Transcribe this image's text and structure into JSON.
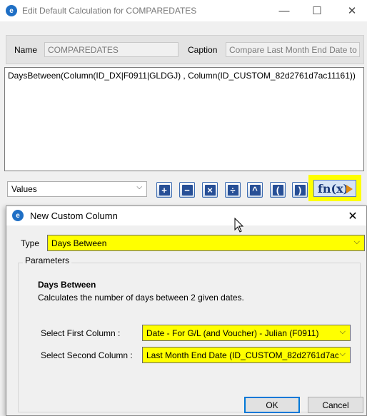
{
  "outer_window": {
    "title": "Edit Default Calculation for COMPAREDATES",
    "minimize_glyph": "—",
    "maximize_glyph": "☐",
    "close_glyph": "✕"
  },
  "name_field": {
    "label": "Name",
    "value": "COMPAREDATES"
  },
  "caption_field": {
    "label": "Caption",
    "value": "Compare Last Month End Date to C"
  },
  "expression": "DaysBetween(Column(ID_DX|F0911|GLDGJ) , Column(ID_CUSTOM_82d2761d7ac11161))",
  "values_dropdown": {
    "selected": "Values"
  },
  "operators": [
    {
      "name": "add-operator-button",
      "glyph": "+"
    },
    {
      "name": "subtract-operator-button",
      "glyph": "−"
    },
    {
      "name": "multiply-operator-button",
      "glyph": "×"
    },
    {
      "name": "divide-operator-button",
      "glyph": "÷"
    },
    {
      "name": "power-operator-button",
      "glyph": "^"
    },
    {
      "name": "open-paren-button",
      "glyph": "("
    },
    {
      "name": "close-paren-button",
      "glyph": ")"
    }
  ],
  "fn_button": {
    "label": "fn(x)"
  },
  "dialog": {
    "title": "New Custom Column",
    "close_glyph": "✕",
    "type_label": "Type",
    "type_value": "Days Between",
    "parameters_legend": "Parameters",
    "section_heading": "Days Between",
    "section_description": "Calculates the number of days between 2 given dates.",
    "first_column_label": "Select First Column :",
    "first_column_value": "Date - For G/L (and Voucher) - Julian (F0911)",
    "second_column_label": "Select Second Column :",
    "second_column_value": "Last Month End Date (ID_CUSTOM_82d2761d7ac",
    "ok_label": "OK",
    "cancel_label": "Cancel"
  },
  "colors": {
    "highlight": "#ffff00",
    "accent": "#0078d7",
    "icon_blue": "#1f6fc5"
  }
}
